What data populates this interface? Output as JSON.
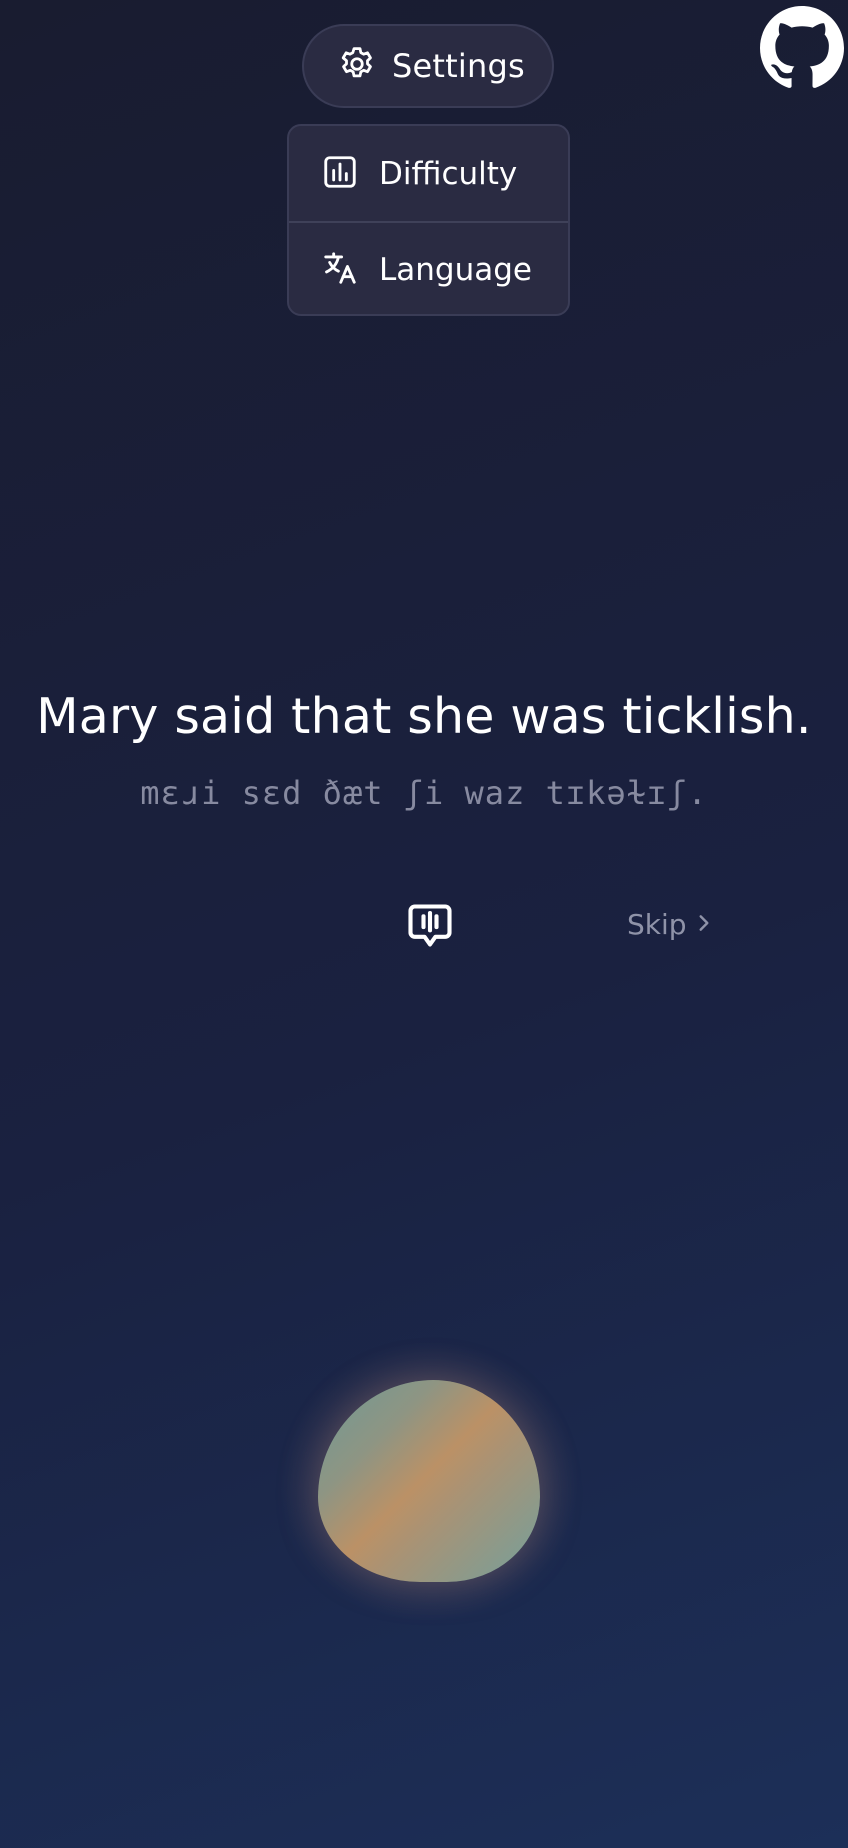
{
  "header": {
    "settings_label": "Settings",
    "settings_icon": "gear-icon",
    "github_icon": "github-icon"
  },
  "menu": {
    "items": [
      {
        "label": "Difficulty",
        "icon": "bar-chart-icon"
      },
      {
        "label": "Language",
        "icon": "translate-icon"
      }
    ]
  },
  "main": {
    "sentence": "Mary said that she was ticklish.",
    "ipa": "mɛɹi sɛd ðæt ʃi waz tɪkəɫɪʃ.",
    "speak_icon": "speech-bubble-audio-icon",
    "skip_label": "Skip",
    "skip_icon": "chevron-right-icon"
  },
  "record": {
    "orb_icon": "recording-orb",
    "colors": [
      "#6f9a96",
      "#bb9166",
      "#74a09c"
    ]
  },
  "colors": {
    "background_top": "#191c30",
    "background_bottom": "#1c2f58",
    "panel": "#2a2b42",
    "panel_border": "#3a3c56",
    "muted_text": "#878aa0"
  }
}
